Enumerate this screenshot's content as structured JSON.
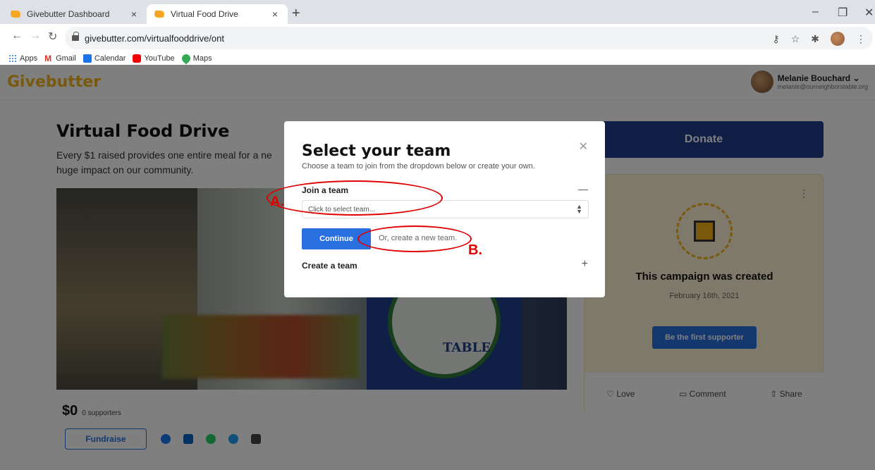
{
  "browser": {
    "tabs": [
      {
        "title": "Givebutter Dashboard"
      },
      {
        "title": "Virtual Food Drive"
      }
    ],
    "url": "givebutter.com/virtualfooddrive/ont",
    "bookmarks": [
      "Apps",
      "Gmail",
      "Calendar",
      "YouTube",
      "Maps"
    ]
  },
  "header": {
    "logo": "Givebutter",
    "user_name": "Melanie Bouchard",
    "user_email": "melanie@ourneighborstable.org"
  },
  "campaign": {
    "title": "Virtual Food Drive",
    "description": "Every $1 raised provides one entire meal for a ne huge impact on our community.",
    "hero_text": "TABLE",
    "amount": "$0",
    "supporters": "0 supporters",
    "fundraise_label": "Fundraise"
  },
  "sidebar": {
    "donate_label": "Donate",
    "card_title": "This campaign was created",
    "card_date": "February 16th, 2021",
    "first_supporter_label": "Be the first supporter",
    "love_label": "Love",
    "comment_label": "Comment",
    "share_label": "Share"
  },
  "modal": {
    "title": "Select your team",
    "subtitle": "Choose a team to join from the dropdown below or create your own.",
    "join_heading": "Join a team",
    "select_placeholder": "Click to select team...",
    "continue_label": "Continue",
    "or_create": "Or, create a new team.",
    "create_heading": "Create a team"
  },
  "annotations": {
    "a_label": "A.",
    "b_label": "B.",
    "color": "#e00000"
  },
  "colors": {
    "brand": "#f2b21b",
    "primary_blue": "#2a6fe0",
    "donate_blue": "#1f3c8a"
  }
}
